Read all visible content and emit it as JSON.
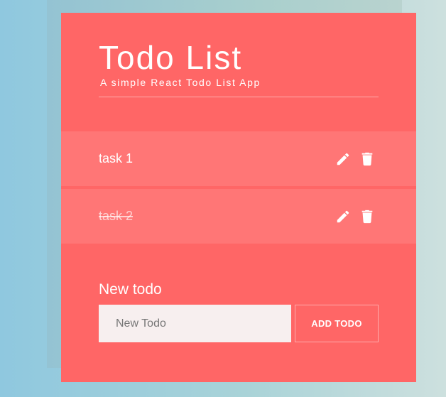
{
  "app": {
    "title": "Todo List",
    "subtitle": "A simple React Todo List App"
  },
  "todos": [
    {
      "text": "task 1",
      "completed": false
    },
    {
      "text": "task 2",
      "completed": true
    }
  ],
  "icons": {
    "edit": "pencil-icon",
    "delete": "trash-icon"
  },
  "form": {
    "label": "New todo",
    "placeholder": "New Todo",
    "value": "",
    "button_label": "ADD TODO"
  },
  "colors": {
    "card": "#ff6666",
    "item": "#ff7676",
    "input_bg": "#f7efef"
  }
}
